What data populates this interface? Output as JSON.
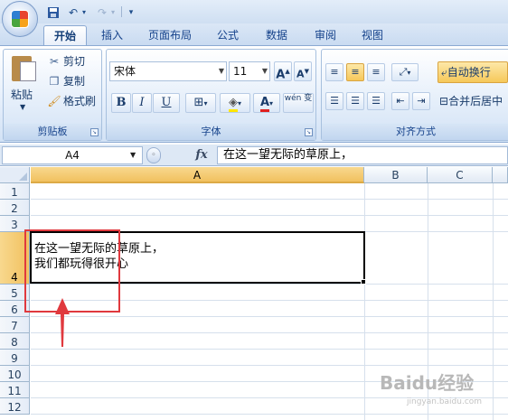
{
  "quick_access": {
    "save_icon": "save-icon",
    "undo_icon": "undo-icon",
    "redo_icon": "redo-icon",
    "customize_glyph": "▾"
  },
  "tabs": [
    {
      "label": "开始",
      "active": true
    },
    {
      "label": "插入"
    },
    {
      "label": "页面布局"
    },
    {
      "label": "公式"
    },
    {
      "label": "数据"
    },
    {
      "label": "审阅"
    },
    {
      "label": "视图"
    }
  ],
  "ribbon": {
    "clipboard": {
      "paste_label": "粘贴",
      "cut_label": "剪切",
      "copy_label": "复制",
      "format_painter_label": "格式刷",
      "group_label": "剪贴板"
    },
    "font": {
      "font_name": "宋体",
      "font_size": "11",
      "grow_glyph": "A",
      "shrink_glyph": "A",
      "bold": "B",
      "italic": "I",
      "underline": "U",
      "font_color_glyph": "A",
      "phonetic_glyph": "wén 变",
      "group_label": "字体"
    },
    "alignment": {
      "wrap_text_label": "自动换行",
      "merge_center_label": "合并后居中",
      "group_label": "对齐方式"
    }
  },
  "formula_bar": {
    "name_box": "A4",
    "fx_label": "fx",
    "content": "在这一望无际的草原上，"
  },
  "grid": {
    "columns": [
      "A",
      "B",
      "C"
    ],
    "selected_column": "A",
    "rows": [
      "1",
      "2",
      "3",
      "4",
      "5",
      "6",
      "7",
      "8",
      "9",
      "10",
      "11",
      "12"
    ],
    "selected_row": "4",
    "cell_a4_line1": "在这一望无际的草原上，",
    "cell_a4_line2": "我们都玩得很开心"
  },
  "colors": {
    "annotation_red": "#e0393e",
    "selection_header": "#f1c15f"
  },
  "watermark": {
    "text": "Baidu经验",
    "sub": "jingyan.baidu.com"
  }
}
